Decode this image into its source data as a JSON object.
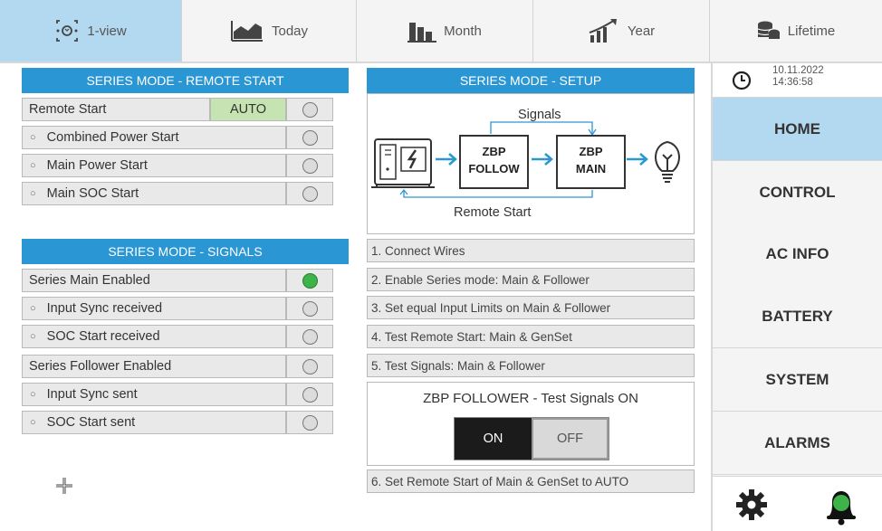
{
  "tabs": [
    {
      "label": "1-view",
      "icon": "network-icon",
      "active": true
    },
    {
      "label": "Today",
      "icon": "area-chart-icon",
      "active": false
    },
    {
      "label": "Month",
      "icon": "bar-chart-icon",
      "active": false
    },
    {
      "label": "Year",
      "icon": "growth-chart-icon",
      "active": false
    },
    {
      "label": "Lifetime",
      "icon": "coins-icon",
      "active": false
    }
  ],
  "remote_start": {
    "title": "SERIES MODE - REMOTE START",
    "rows": [
      {
        "label": "Remote Start",
        "value": "AUTO",
        "indicator": "off",
        "sub": false
      },
      {
        "label": "Combined Power Start",
        "indicator": "off",
        "sub": true
      },
      {
        "label": "Main Power Start",
        "indicator": "off",
        "sub": true
      },
      {
        "label": "Main SOC Start",
        "indicator": "off",
        "sub": true
      }
    ]
  },
  "signals": {
    "title": "SERIES MODE - SIGNALS",
    "rows": [
      {
        "label": "Series Main Enabled",
        "indicator": "on",
        "sub": false
      },
      {
        "label": "Input Sync received",
        "indicator": "off",
        "sub": true
      },
      {
        "label": "SOC Start received",
        "indicator": "off",
        "sub": true
      },
      {
        "label": "Series Follower Enabled",
        "indicator": "off",
        "sub": false
      },
      {
        "label": "Input Sync sent",
        "indicator": "off",
        "sub": true
      },
      {
        "label": "SOC Start sent",
        "indicator": "off",
        "sub": true
      }
    ]
  },
  "setup": {
    "title": "SERIES MODE - SETUP",
    "diagram": {
      "signals_label": "Signals",
      "remote_start_label": "Remote Start",
      "box1_line1": "ZBP",
      "box1_line2": "FOLLOW",
      "box2_line1": "ZBP",
      "box2_line2": "MAIN"
    },
    "steps": [
      "1. Connect Wires",
      "2. Enable Series mode: Main & Follower",
      "3. Set equal Input Limits on Main & Follower",
      "4. Test Remote Start: Main & GenSet",
      "5. Test Signals: Main & Follower"
    ],
    "test_title": "ZBP FOLLOWER - Test Signals ON",
    "toggle_on": "ON",
    "toggle_off": "OFF",
    "toggle_state": "ON",
    "step6": "6. Set Remote Start of Main & GenSet to AUTO"
  },
  "sidebar": {
    "date": "10.11.2022",
    "time": "14:36:58",
    "nav": [
      "HOME",
      "CONTROL",
      "AC INFO",
      "BATTERY",
      "SYSTEM",
      "ALARMS"
    ],
    "active": "HOME"
  },
  "colors": {
    "header_blue": "#2a97d4",
    "active_tab": "#b3d9f0",
    "led_on": "#3db34a",
    "auto_green": "#c5e4b1",
    "alarm_bell": "#3db34a"
  }
}
